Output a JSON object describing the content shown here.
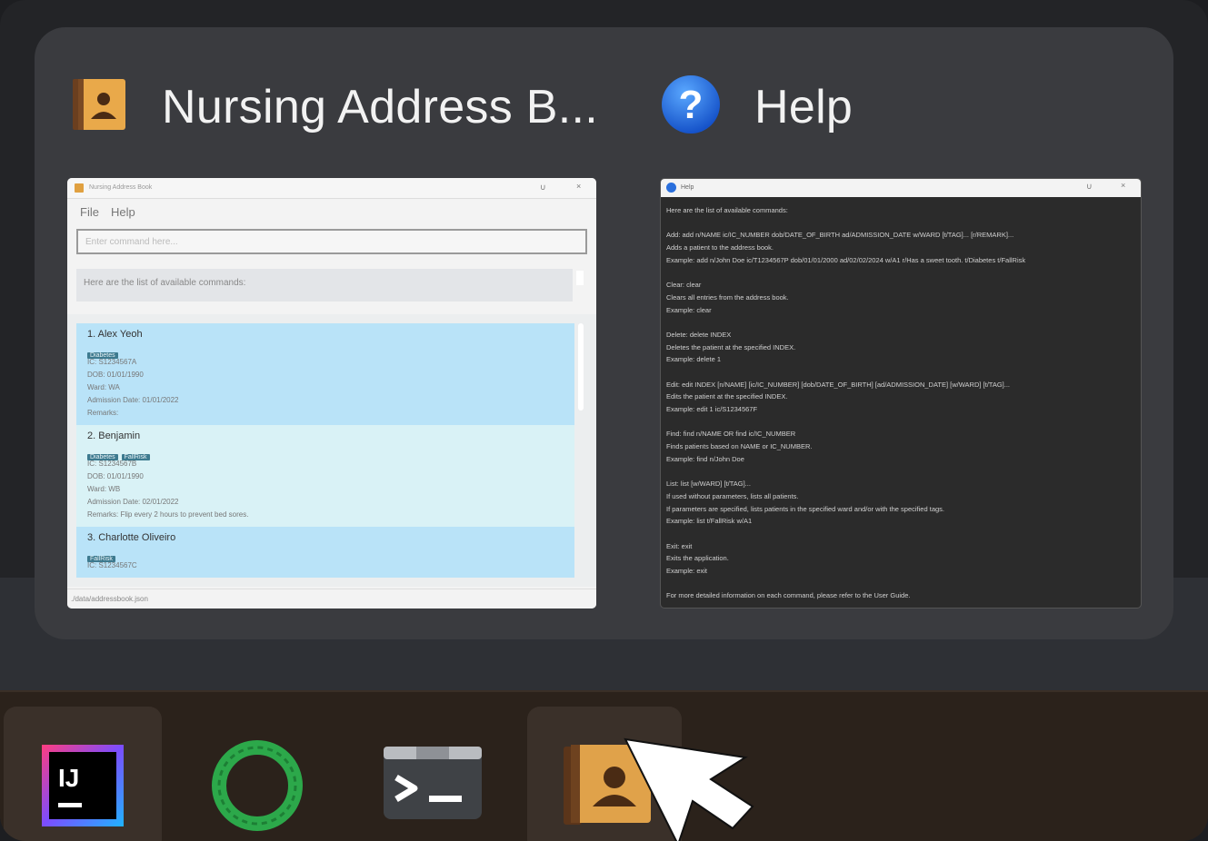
{
  "switcher": {
    "windows": [
      {
        "title": "Nursing Address B...",
        "icon": "address-book-icon",
        "preview": {
          "window_title": "Nursing Address Book",
          "menu": [
            "File",
            "Help"
          ],
          "command_placeholder": "Enter command here...",
          "result_text": "Here are the list of available commands:",
          "patients": [
            {
              "heading": "1.  Alex Yeoh",
              "tags": [
                "Diabetes"
              ],
              "lines": [
                "IC: S1234567A",
                "DOB: 01/01/1990",
                "Ward: WA",
                "Admission Date: 01/01/2022",
                "Remarks: "
              ]
            },
            {
              "heading": "2.  Benjamin",
              "tags": [
                "Diabetes",
                "FallRisk"
              ],
              "lines": [
                "IC: S1234567B",
                "DOB: 01/01/1990",
                "Ward: WB",
                "Admission Date: 02/01/2022",
                "Remarks: Flip every 2 hours to prevent bed sores."
              ]
            },
            {
              "heading": "3.  Charlotte Oliveiro",
              "tags": [
                "FallRisk"
              ],
              "lines": [
                "IC: S1234567C"
              ]
            }
          ],
          "status": "./data/addressbook.json"
        }
      },
      {
        "title": "Help",
        "icon": "help-icon",
        "preview": {
          "window_title": "Help",
          "lines": [
            "Here are the list of available commands:",
            "",
            "Add: add n/NAME ic/IC_NUMBER dob/DATE_OF_BIRTH ad/ADMISSION_DATE w/WARD [t/TAG]... [r/REMARK]...",
            "    Adds a patient to the address book.",
            "    Example: add n/John Doe ic/T1234567P dob/01/01/2000 ad/02/02/2024 w/A1 r/Has a sweet tooth. t/Diabetes t/FallRisk",
            "",
            "Clear: clear",
            "    Clears all entries from the address book.",
            "    Example: clear",
            "",
            "Delete: delete INDEX",
            "    Deletes the patient at the specified INDEX.",
            "    Example: delete 1",
            "",
            "Edit: edit INDEX [n/NAME] [ic/IC_NUMBER] [dob/DATE_OF_BIRTH] [ad/ADMISSION_DATE] [w/WARD] [t/TAG]...",
            "    Edits the patient at the specified INDEX.",
            "    Example: edit 1 ic/S1234567F",
            "",
            "Find: find n/NAME OR find ic/IC_NUMBER",
            "    Finds patients based on NAME or IC_NUMBER.",
            "    Example: find n/John Doe",
            "",
            "List: list [w/WARD] [t/TAG]...",
            "    If used without parameters, lists all patients.",
            "    If parameters are specified, lists patients in the specified ward and/or with the specified tags.",
            "    Example: list t/FallRisk w/A1",
            "",
            "Exit: exit",
            "    Exits the application.",
            "    Example: exit",
            "",
            "For more detailed information on each command, please refer to the User Guide."
          ]
        }
      }
    ]
  },
  "taskbar": {
    "apps": [
      {
        "name": "IntelliJ IDEA",
        "icon": "intellij-icon",
        "label": "IJ"
      },
      {
        "name": "Sourcetree",
        "icon": "sourcetree-ring-icon"
      },
      {
        "name": "Terminal",
        "icon": "terminal-icon"
      },
      {
        "name": "Nursing Address Book",
        "icon": "address-book-icon"
      }
    ]
  },
  "colors": {
    "switcher_bg": "#3a3b3f",
    "taskbar_bg": "#2b221b",
    "card_blue": "#b9e3f8",
    "card_light": "#d9f2f6",
    "tag_bg": "#3d7a8f"
  }
}
